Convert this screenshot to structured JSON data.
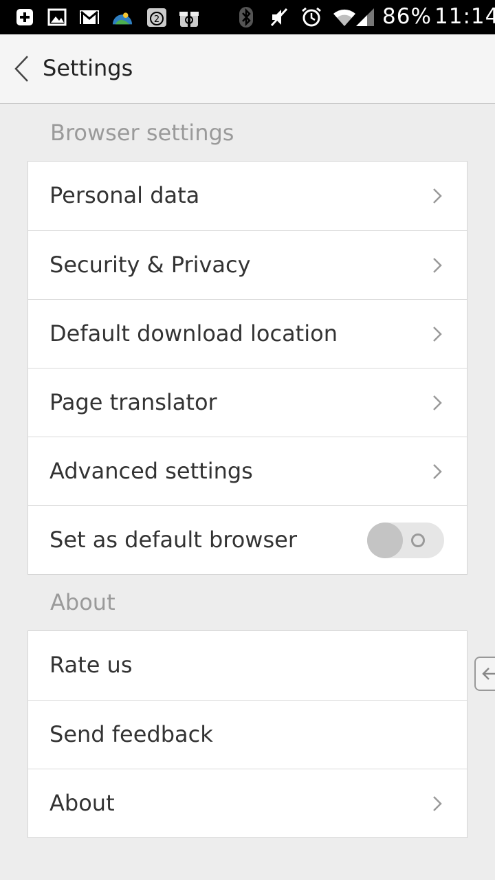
{
  "status_bar": {
    "battery_percent": "86%",
    "time": "11:14",
    "icons": [
      "add-square-icon",
      "image-icon",
      "gmail-icon",
      "weather-icon",
      "calendar-badge-icon",
      "gift-icon",
      "bluetooth-icon",
      "mute-icon",
      "alarm-icon",
      "wifi-icon",
      "signal-icon"
    ],
    "calendar_badge": "2"
  },
  "app_bar": {
    "title": "Settings"
  },
  "sections": {
    "browser": {
      "header": "Browser settings",
      "items": [
        {
          "label": "Personal data"
        },
        {
          "label": "Security & Privacy"
        },
        {
          "label": "Default download location"
        },
        {
          "label": "Page translator"
        },
        {
          "label": "Advanced settings"
        },
        {
          "label": "Set as default browser",
          "toggle_on": false
        }
      ]
    },
    "about": {
      "header": "About",
      "items": [
        {
          "label": "Rate us"
        },
        {
          "label": "Send feedback"
        },
        {
          "label": "About"
        }
      ]
    }
  },
  "colors": {
    "background": "#ededed",
    "card": "#ffffff",
    "section_header": "#9a9a9a",
    "text": "#333333"
  }
}
